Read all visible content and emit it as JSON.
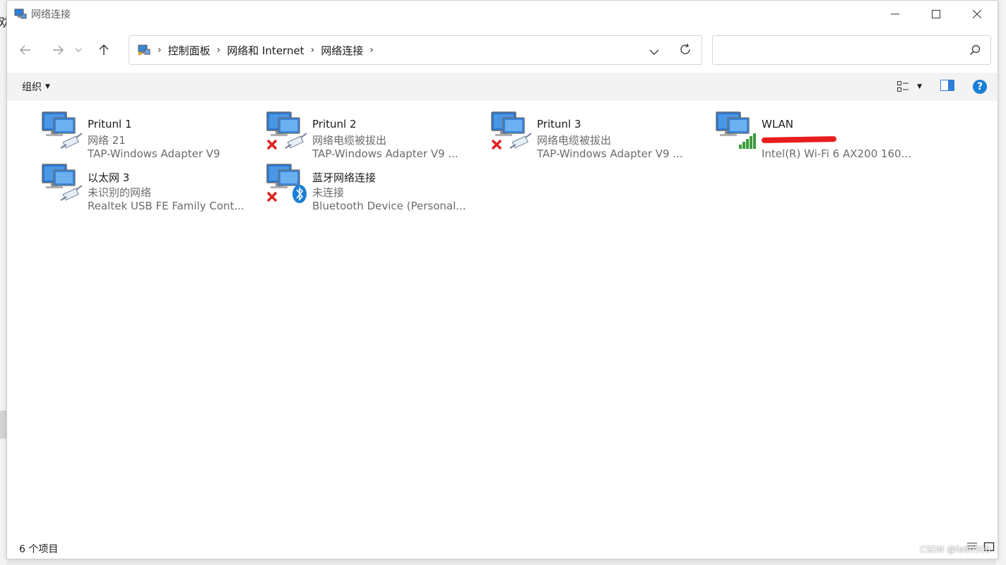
{
  "background": {
    "left_char": "劝"
  },
  "window": {
    "title": "网络连接",
    "controls": {
      "minimize": "minimize-icon",
      "maximize": "maximize-icon",
      "close": "close-icon"
    }
  },
  "nav": {
    "breadcrumb": [
      "控制面板",
      "网络和 Internet",
      "网络连接"
    ],
    "search_placeholder": ""
  },
  "toolbar": {
    "organize_label": "组织",
    "help_label": "?"
  },
  "connections": [
    {
      "name": "Pritunl 1",
      "status": "网络 21",
      "device": "TAP-Windows Adapter V9",
      "badge": "none",
      "type": "ethernet"
    },
    {
      "name": "Pritunl 2",
      "status": "网络电缆被拔出",
      "device": "TAP-Windows Adapter V9 ...",
      "badge": "error",
      "type": "ethernet"
    },
    {
      "name": "Pritunl 3",
      "status": "网络电缆被拔出",
      "device": "TAP-Windows Adapter V9 ...",
      "badge": "error",
      "type": "ethernet"
    },
    {
      "name": "WLAN",
      "status": "",
      "status_redacted": true,
      "device": "Intel(R) Wi-Fi 6 AX200 160...",
      "badge": "signal",
      "type": "wifi"
    },
    {
      "name": "以太网 3",
      "status": "未识别的网络",
      "device": "Realtek USB FE Family Cont...",
      "badge": "none",
      "type": "ethernet"
    },
    {
      "name": "蓝牙网络连接",
      "status": "未连接",
      "device": "Bluetooth Device (Personal...",
      "badge": "error",
      "type": "bluetooth"
    }
  ],
  "statusbar": {
    "count": "6 个项目",
    "watermark": "CSDN @fe60308"
  },
  "colors": {
    "accent": "#1a7fd6",
    "error": "#e02020",
    "signal": "#3c9a3c",
    "redaction": "#e81e1e"
  }
}
